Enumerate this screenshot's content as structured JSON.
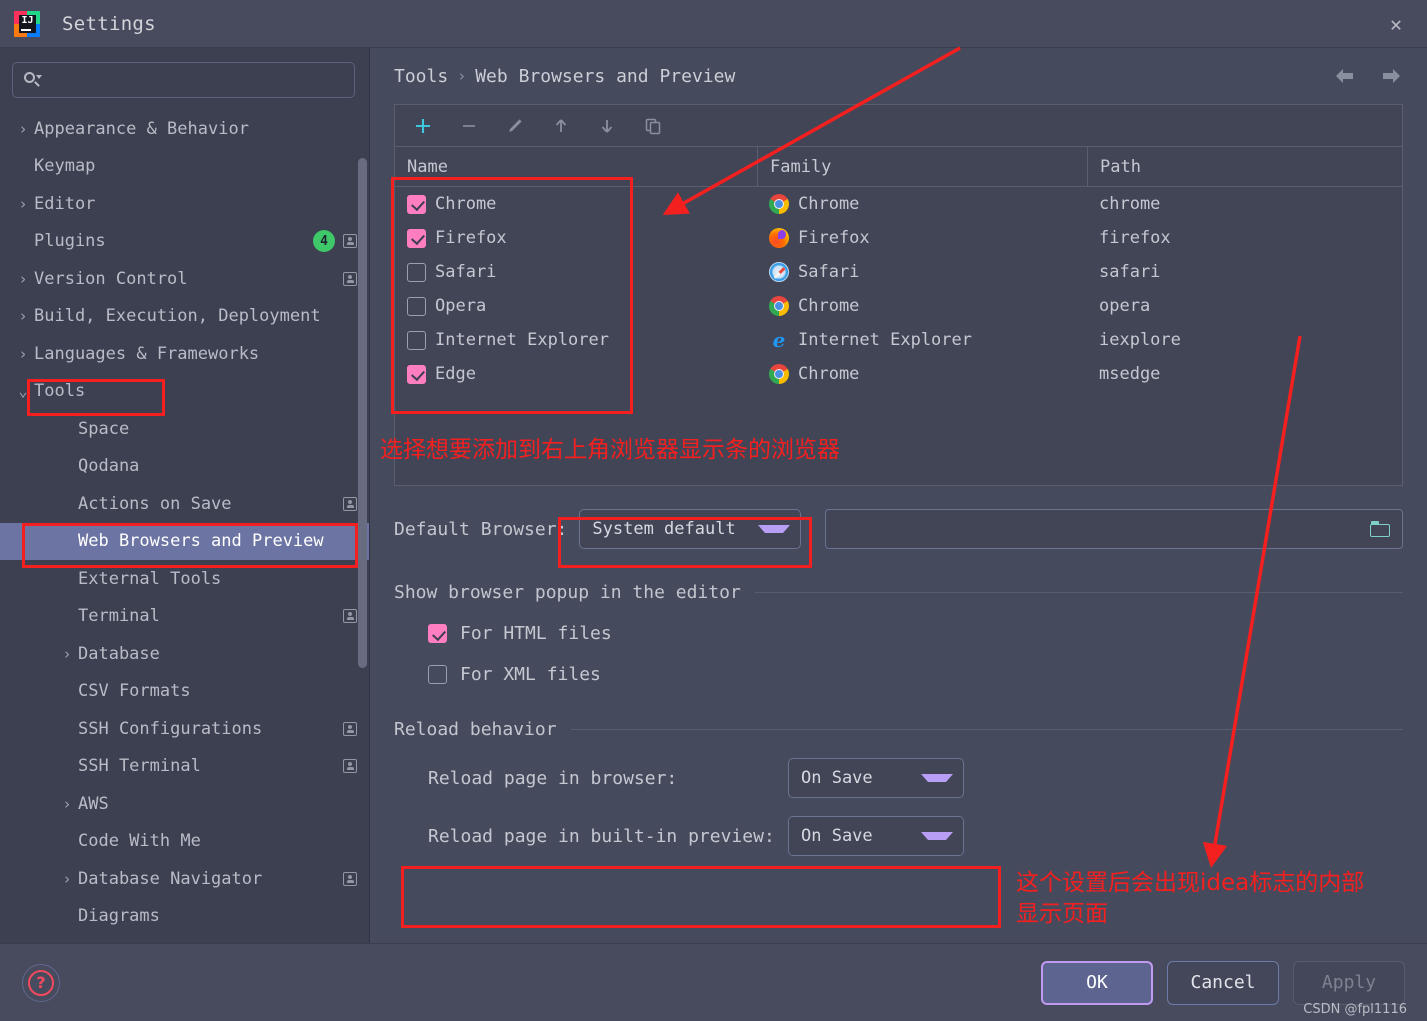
{
  "window": {
    "title": "Settings",
    "logo_text": "IJ",
    "close_label": "✕"
  },
  "search": {
    "value": "",
    "placeholder": ""
  },
  "sidebar": {
    "items": [
      {
        "label": "Appearance & Behavior",
        "arrow": "›",
        "level": 0,
        "selected": false,
        "badge": null,
        "sync": false
      },
      {
        "label": "Keymap",
        "arrow": "",
        "level": 0,
        "selected": false,
        "badge": null,
        "sync": false
      },
      {
        "label": "Editor",
        "arrow": "›",
        "level": 0,
        "selected": false,
        "badge": null,
        "sync": false
      },
      {
        "label": "Plugins",
        "arrow": "",
        "level": 0,
        "selected": false,
        "badge": "4",
        "sync": true
      },
      {
        "label": "Version Control",
        "arrow": "›",
        "level": 0,
        "selected": false,
        "badge": null,
        "sync": true
      },
      {
        "label": "Build, Execution, Deployment",
        "arrow": "›",
        "level": 0,
        "selected": false,
        "badge": null,
        "sync": false
      },
      {
        "label": "Languages & Frameworks",
        "arrow": "›",
        "level": 0,
        "selected": false,
        "badge": null,
        "sync": false
      },
      {
        "label": "Tools",
        "arrow": "⌄",
        "level": 0,
        "selected": false,
        "badge": null,
        "sync": false
      },
      {
        "label": "Space",
        "arrow": "",
        "level": 1,
        "selected": false,
        "badge": null,
        "sync": false
      },
      {
        "label": "Qodana",
        "arrow": "",
        "level": 1,
        "selected": false,
        "badge": null,
        "sync": false
      },
      {
        "label": "Actions on Save",
        "arrow": "",
        "level": 1,
        "selected": false,
        "badge": null,
        "sync": true
      },
      {
        "label": "Web Browsers and Preview",
        "arrow": "",
        "level": 1,
        "selected": true,
        "badge": null,
        "sync": false
      },
      {
        "label": "External Tools",
        "arrow": "",
        "level": 1,
        "selected": false,
        "badge": null,
        "sync": false
      },
      {
        "label": "Terminal",
        "arrow": "",
        "level": 1,
        "selected": false,
        "badge": null,
        "sync": true
      },
      {
        "label": "Database",
        "arrow": "›",
        "level": 1,
        "selected": false,
        "badge": null,
        "sync": false
      },
      {
        "label": "CSV Formats",
        "arrow": "",
        "level": 1,
        "selected": false,
        "badge": null,
        "sync": false
      },
      {
        "label": "SSH Configurations",
        "arrow": "",
        "level": 1,
        "selected": false,
        "badge": null,
        "sync": true
      },
      {
        "label": "SSH Terminal",
        "arrow": "",
        "level": 1,
        "selected": false,
        "badge": null,
        "sync": true
      },
      {
        "label": "AWS",
        "arrow": "›",
        "level": 1,
        "selected": false,
        "badge": null,
        "sync": false
      },
      {
        "label": "Code With Me",
        "arrow": "",
        "level": 1,
        "selected": false,
        "badge": null,
        "sync": false
      },
      {
        "label": "Database Navigator",
        "arrow": "›",
        "level": 1,
        "selected": false,
        "badge": null,
        "sync": true
      },
      {
        "label": "Diagrams",
        "arrow": "",
        "level": 1,
        "selected": false,
        "badge": null,
        "sync": false
      }
    ]
  },
  "breadcrumb": {
    "root": "Tools",
    "separator": "›",
    "current": "Web Browsers and Preview"
  },
  "toolbar": {
    "add_label": "+",
    "remove_label": "−",
    "edit_label": "edit",
    "up_label": "↑",
    "down_label": "↓",
    "copy_label": "copy"
  },
  "table": {
    "columns": [
      "Name",
      "Family",
      "Path"
    ],
    "rows": [
      {
        "checked": true,
        "name": "Chrome",
        "family": "Chrome",
        "family_icon": "chrome-icon",
        "path": "chrome"
      },
      {
        "checked": true,
        "name": "Firefox",
        "family": "Firefox",
        "family_icon": "firefox-icon",
        "path": "firefox"
      },
      {
        "checked": false,
        "name": "Safari",
        "family": "Safari",
        "family_icon": "safari-icon",
        "path": "safari"
      },
      {
        "checked": false,
        "name": "Opera",
        "family": "Chrome",
        "family_icon": "chrome-icon",
        "path": "opera"
      },
      {
        "checked": false,
        "name": "Internet Explorer",
        "family": "Internet Explorer",
        "family_icon": "ie-icon",
        "path": "iexplore"
      },
      {
        "checked": true,
        "name": "Edge",
        "family": "Chrome",
        "family_icon": "chrome-icon",
        "path": "msedge"
      }
    ]
  },
  "default_browser": {
    "label": "Default Browser:",
    "value": "System default",
    "path_value": "",
    "path_placeholder": ""
  },
  "popup_group": {
    "title": "Show browser popup in the editor",
    "options": [
      {
        "label": "For HTML files",
        "checked": true
      },
      {
        "label": "For XML files",
        "checked": false
      }
    ]
  },
  "reload_group": {
    "title": "Reload behavior",
    "rows": [
      {
        "label": "Reload page in browser:",
        "value": "On Save"
      },
      {
        "label": "Reload page in built-in preview:",
        "value": "On Save"
      }
    ]
  },
  "footer": {
    "ok_label": "OK",
    "cancel_label": "Cancel",
    "apply_label": "Apply",
    "help_label": "?",
    "watermark": "CSDN @fpl1116"
  },
  "annotations": {
    "note_table": "选择想要添加到右上角浏览器显示条的浏览器",
    "note_reload_line1": "这个设置后会出现idea标志的内部",
    "note_reload_line2": "显示页面",
    "color": "#f42020"
  }
}
